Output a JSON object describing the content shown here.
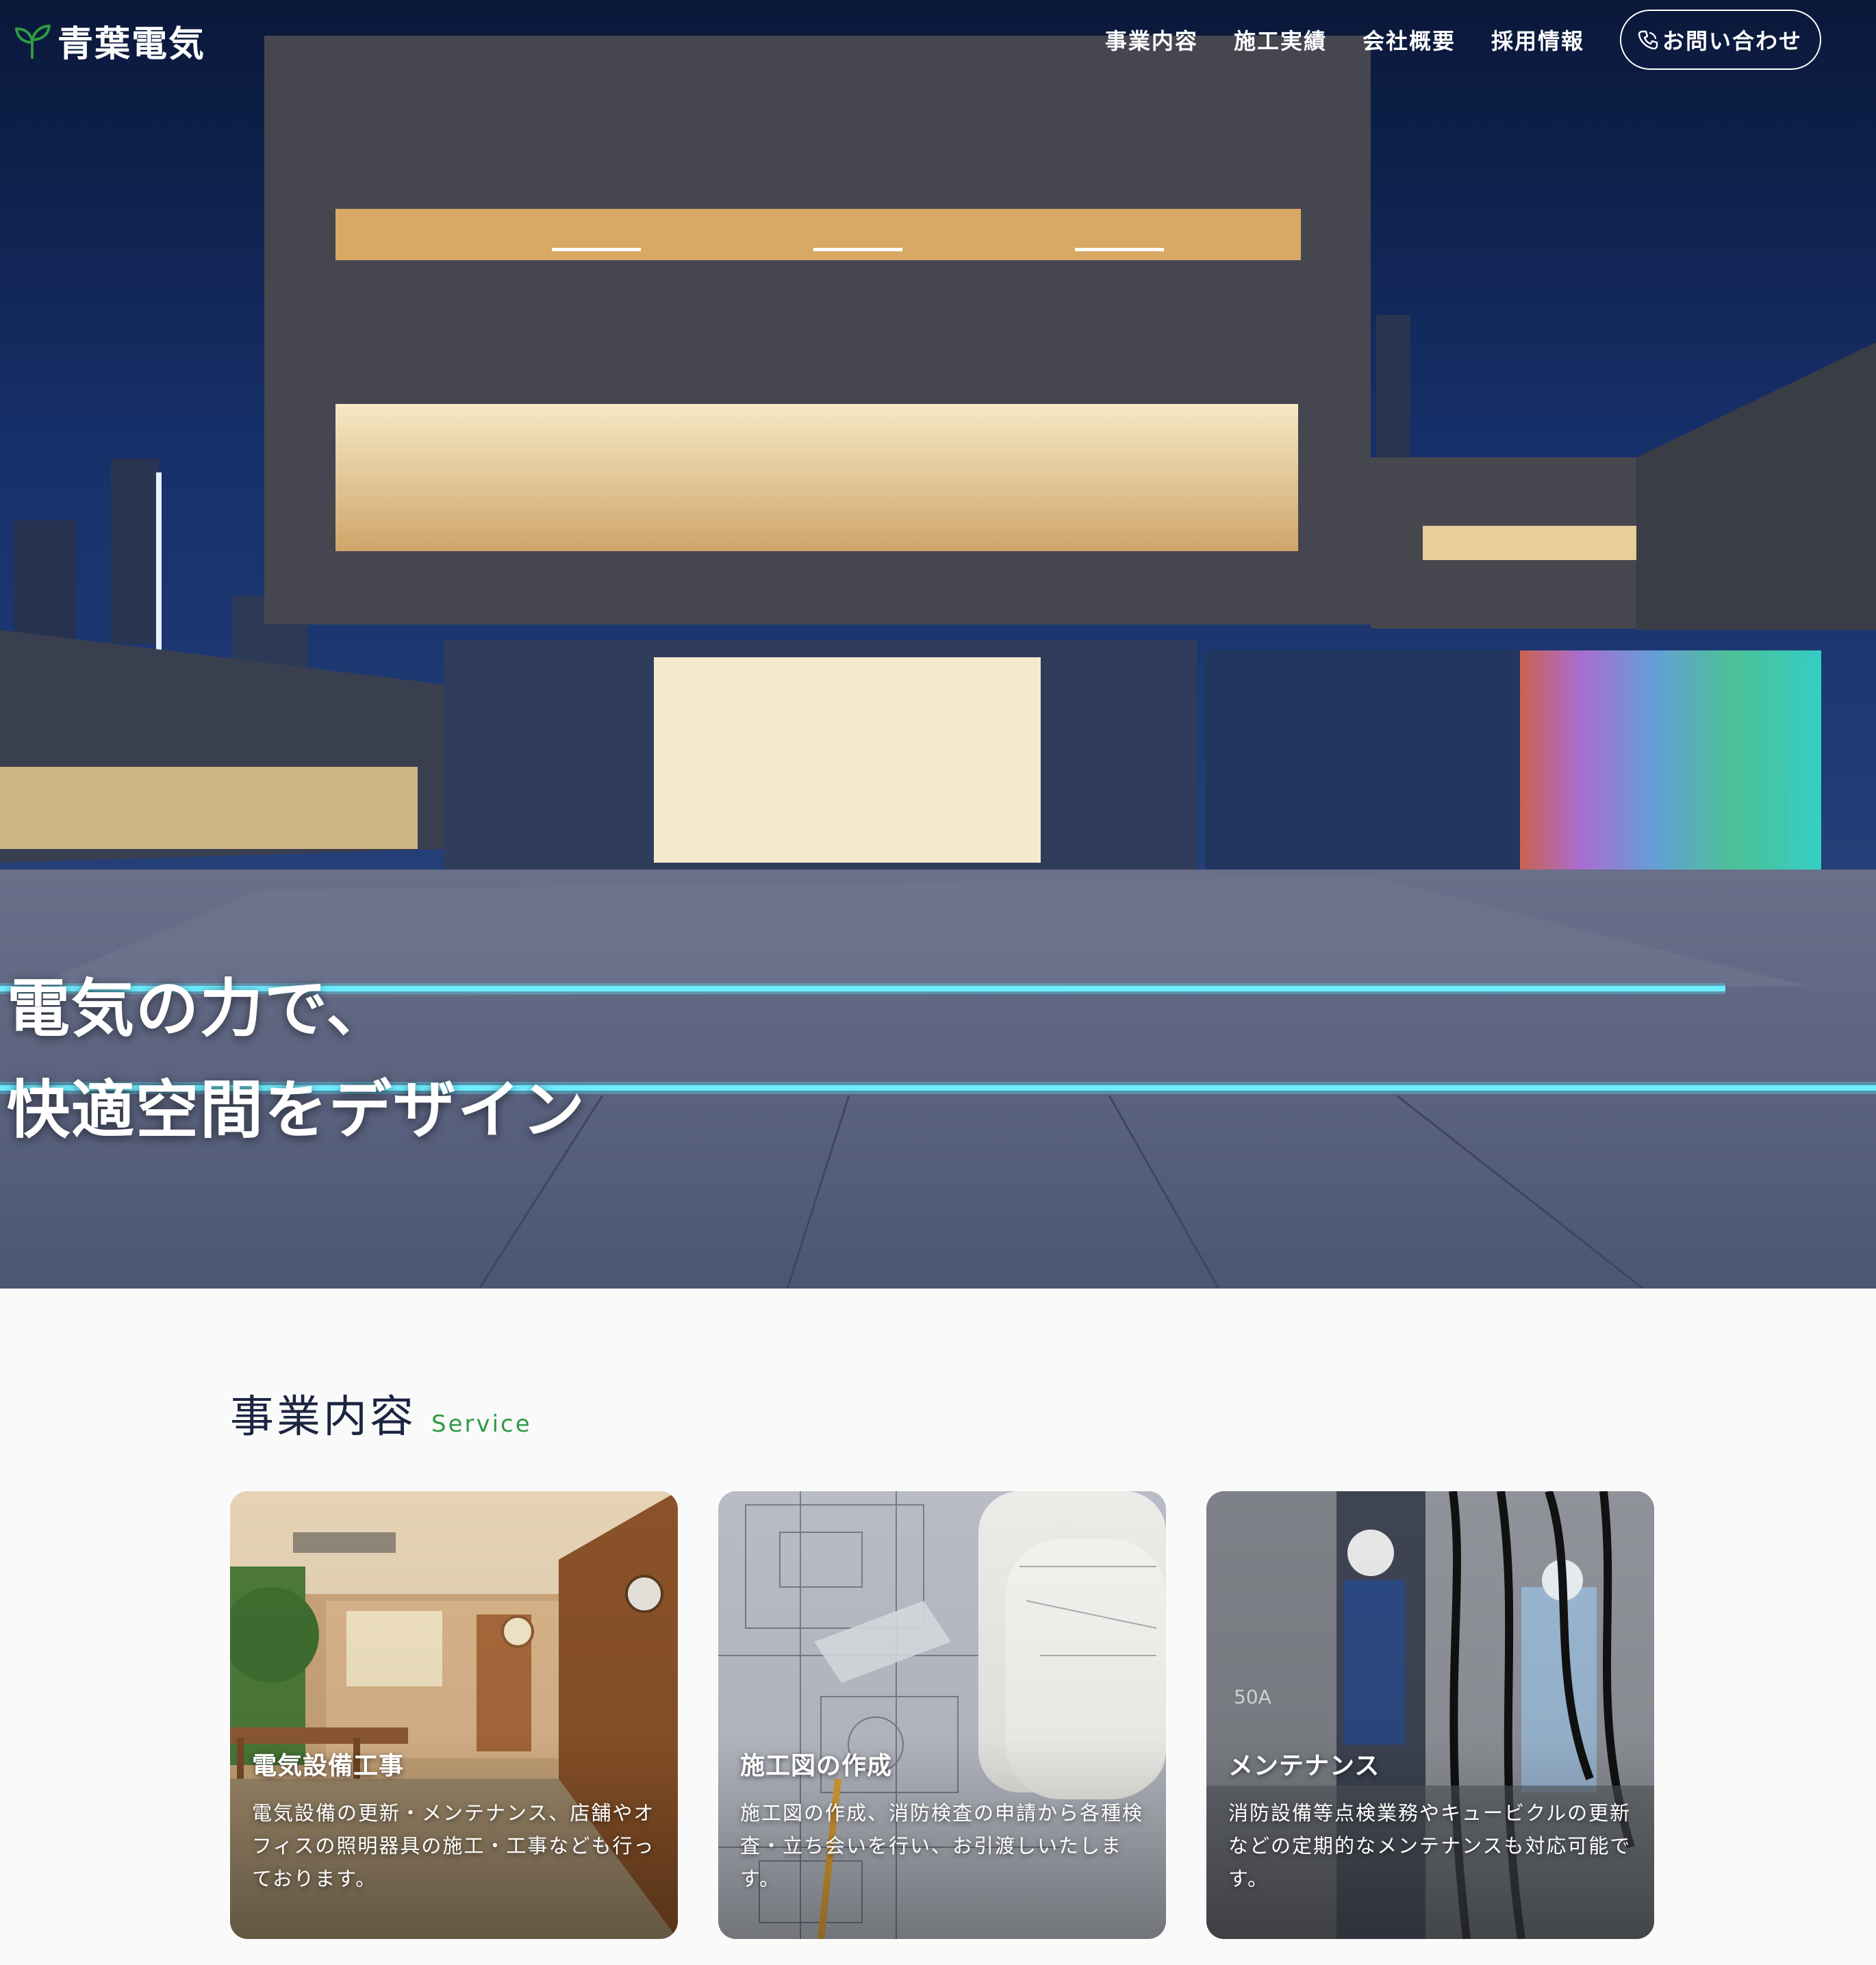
{
  "header": {
    "logo_text": "青葉電気",
    "nav": [
      "事業内容",
      "施工実績",
      "会社概要",
      "採用情報"
    ],
    "contact_label": "お問い合わせ"
  },
  "hero": {
    "headline_line1": "電気の力で、",
    "headline_line2": "快適空間をデザイン"
  },
  "service": {
    "title_ja": "事業内容",
    "title_en": "Service",
    "cards": [
      {
        "title": "電気設備工事",
        "description": "電気設備の更新・メンテナンス、店舗やオフィスの照明器具の施工・工事なども行っております。"
      },
      {
        "title": "施工図の作成",
        "description": "施工図の作成、消防検査の申請から各種検査・立ち会いを行い、お引渡しいたします。"
      },
      {
        "title": "メンテナンス",
        "description": "消防設備等点検業務やキュービクルの更新などの定期的なメンテナンスも対応可能です。"
      }
    ]
  },
  "colors": {
    "brand_green": "#2e9b45",
    "heading_navy": "#1b2440",
    "accent_cyan": "#4fe6ff"
  },
  "icons": {
    "logo": "sprout-icon",
    "contact": "phone-icon"
  }
}
